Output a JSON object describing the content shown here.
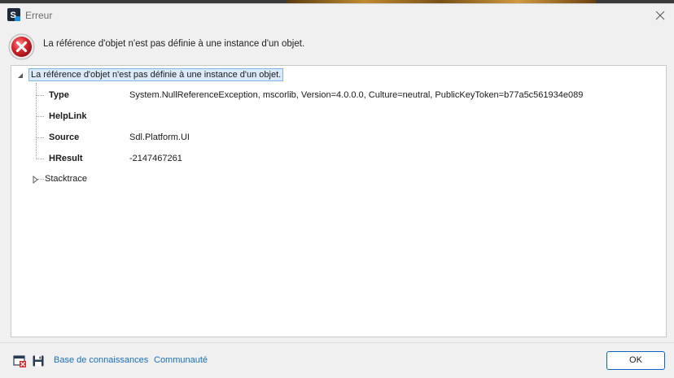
{
  "window": {
    "title": "Erreur",
    "colors": {
      "accent": "#0a64c8",
      "error_red": "#c8242a",
      "link": "#1a6fc0",
      "selection": "#dbeaf8"
    }
  },
  "header": {
    "message": "La référence d'objet n'est pas définie à une instance d'un objet."
  },
  "tree": {
    "root_label": "La référence d'objet n'est pas définie à une instance d'un objet.",
    "properties": [
      {
        "name": "Type",
        "value": "System.NullReferenceException, mscorlib, Version=4.0.0.0, Culture=neutral, PublicKeyToken=b77a5c561934e089"
      },
      {
        "name": "HelpLink",
        "value": ""
      },
      {
        "name": "Source",
        "value": "Sdl.Platform.UI"
      },
      {
        "name": "HResult",
        "value": "-2147467261"
      }
    ],
    "stacktrace_label": "Stacktrace"
  },
  "footer": {
    "icons": [
      "error-log-icon",
      "save-icon"
    ],
    "links": [
      "Base de connaissances",
      "Communauté"
    ],
    "ok_label": "OK"
  }
}
